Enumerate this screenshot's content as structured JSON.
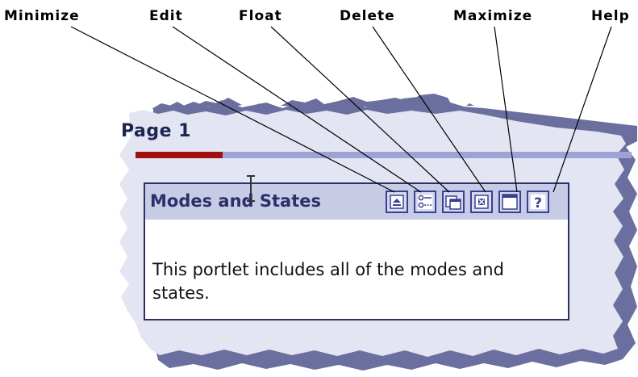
{
  "callouts": {
    "minimize": "Minimize",
    "edit": "Edit",
    "float": "Float",
    "delete": "Delete",
    "maximize": "Maximize",
    "help": "Help"
  },
  "page": {
    "tab_label": "Page 1"
  },
  "portlet": {
    "title": "Modes and States",
    "body_text": "This portlet includes all of the modes and states.",
    "buttons": [
      {
        "name": "minimize",
        "icon": "minimize-icon"
      },
      {
        "name": "edit",
        "icon": "edit-icon"
      },
      {
        "name": "float",
        "icon": "float-icon"
      },
      {
        "name": "delete",
        "icon": "delete-icon"
      },
      {
        "name": "maximize",
        "icon": "maximize-icon"
      },
      {
        "name": "help",
        "icon": "help-icon",
        "glyph": "?"
      }
    ]
  },
  "colors": {
    "portlet_border": "#2b3168",
    "header_bg": "#c8cbe6",
    "tab_active": "#a01010",
    "tab_rule": "#9ea2d4",
    "torn_page": "#e3e5f2",
    "torn_shadow": "#6b6fa0"
  }
}
